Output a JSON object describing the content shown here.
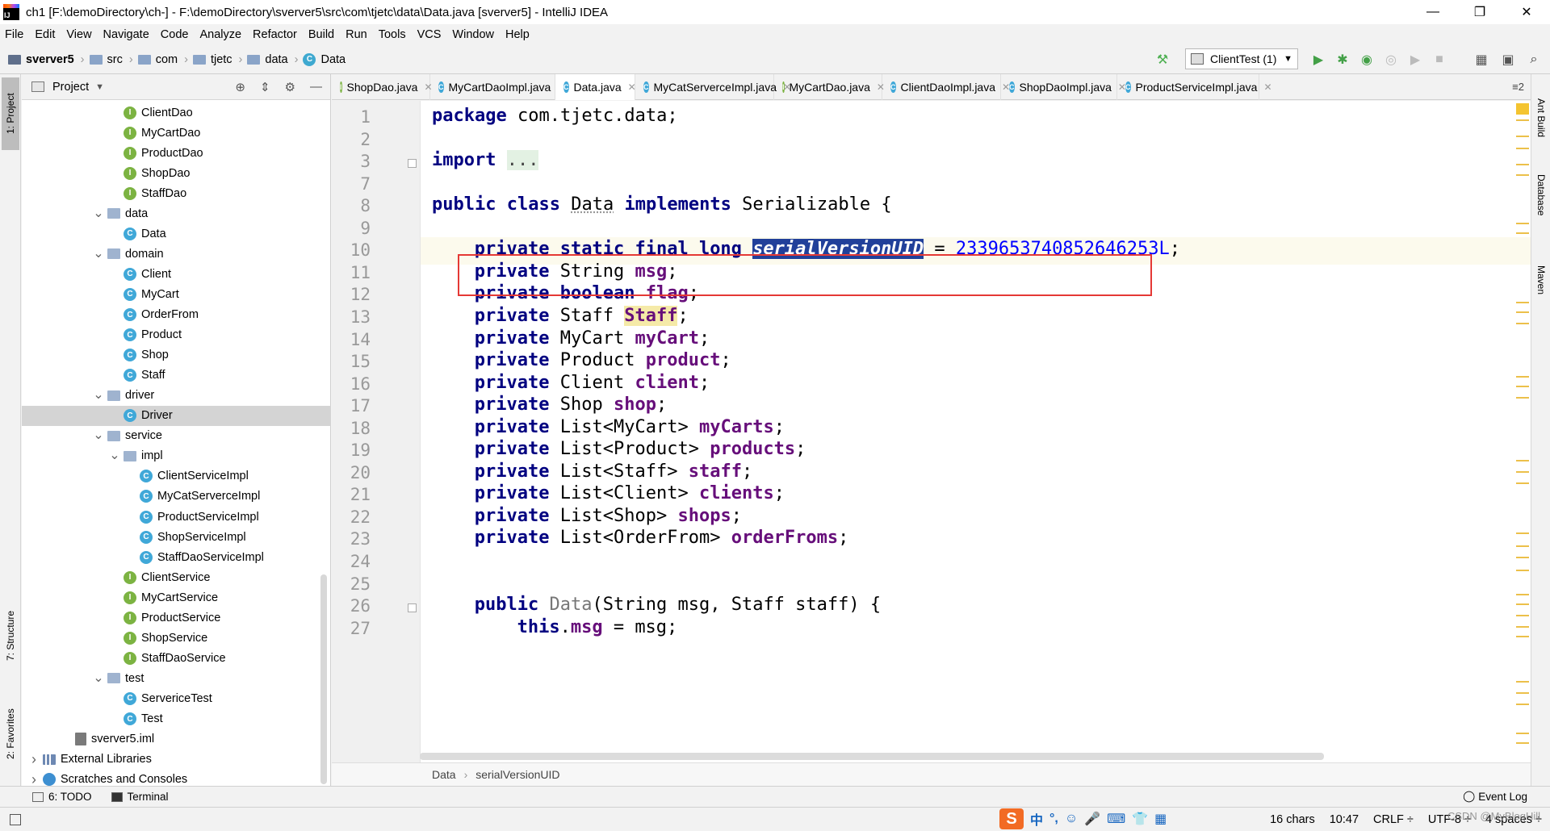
{
  "window": {
    "title": "ch1 [F:\\demoDirectory\\ch-] - F:\\demoDirectory\\sverver5\\src\\com\\tjetc\\data\\Data.java [sverver5] - IntelliJ IDEA",
    "min": "—",
    "max": "❐",
    "close": "✕"
  },
  "menu": [
    "File",
    "Edit",
    "View",
    "Navigate",
    "Code",
    "Analyze",
    "Refactor",
    "Build",
    "Run",
    "Tools",
    "VCS",
    "Window",
    "Help"
  ],
  "breadcrumb": {
    "project": "sverver5",
    "parts": [
      "src",
      "com",
      "tjetc",
      "data"
    ],
    "file": "Data"
  },
  "toolbar": {
    "run_config": "ClientTest (1)",
    "icons": [
      "hammer-icon",
      "run-icon",
      "debug-icon",
      "coverage-icon",
      "profile-icon",
      "run-gray-icon",
      "stop-icon",
      "project-structure-icon",
      "layout-icon",
      "search-icon"
    ]
  },
  "left_strip": {
    "project": "1: Project",
    "structure": "7: Structure",
    "favorites": "2: Favorites"
  },
  "right_strip": {
    "ant": "Ant Build",
    "database": "Database",
    "maven": "Maven"
  },
  "project_panel": {
    "title": "Project",
    "tree": [
      {
        "label": "ClientDao",
        "type": "interface",
        "depth": 5
      },
      {
        "label": "MyCartDao",
        "type": "interface",
        "depth": 5
      },
      {
        "label": "ProductDao",
        "type": "interface",
        "depth": 5
      },
      {
        "label": "ShopDao",
        "type": "interface",
        "depth": 5
      },
      {
        "label": "StaffDao",
        "type": "interface",
        "depth": 5
      },
      {
        "label": "data",
        "type": "folder",
        "depth": 4,
        "expanded": true
      },
      {
        "label": "Data",
        "type": "class",
        "depth": 5
      },
      {
        "label": "domain",
        "type": "folder",
        "depth": 4,
        "expanded": true
      },
      {
        "label": "Client",
        "type": "class",
        "depth": 5
      },
      {
        "label": "MyCart",
        "type": "class",
        "depth": 5
      },
      {
        "label": "OrderFrom",
        "type": "class",
        "depth": 5
      },
      {
        "label": "Product",
        "type": "class",
        "depth": 5
      },
      {
        "label": "Shop",
        "type": "class",
        "depth": 5
      },
      {
        "label": "Staff",
        "type": "class",
        "depth": 5
      },
      {
        "label": "driver",
        "type": "folder",
        "depth": 4,
        "expanded": true
      },
      {
        "label": "Driver",
        "type": "class",
        "depth": 5,
        "selected": true
      },
      {
        "label": "service",
        "type": "folder",
        "depth": 4,
        "expanded": true
      },
      {
        "label": "impl",
        "type": "folder",
        "depth": 5,
        "expanded": true
      },
      {
        "label": "ClientServiceImpl",
        "type": "class",
        "depth": 6
      },
      {
        "label": "MyCatServerceImpl",
        "type": "class",
        "depth": 6
      },
      {
        "label": "ProductServiceImpl",
        "type": "class",
        "depth": 6
      },
      {
        "label": "ShopServiceImpl",
        "type": "class",
        "depth": 6
      },
      {
        "label": "StaffDaoServiceImpl",
        "type": "class",
        "depth": 6
      },
      {
        "label": "ClientService",
        "type": "interface",
        "depth": 5
      },
      {
        "label": "MyCartService",
        "type": "interface",
        "depth": 5
      },
      {
        "label": "ProductService",
        "type": "interface",
        "depth": 5
      },
      {
        "label": "ShopService",
        "type": "interface",
        "depth": 5
      },
      {
        "label": "StaffDaoService",
        "type": "interface",
        "depth": 5
      },
      {
        "label": "test",
        "type": "folder",
        "depth": 4,
        "expanded": true
      },
      {
        "label": "ServericeTest",
        "type": "class",
        "depth": 5
      },
      {
        "label": "Test",
        "type": "class",
        "depth": 5
      },
      {
        "label": "sverver5.iml",
        "type": "iml",
        "depth": 2
      },
      {
        "label": "External Libraries",
        "type": "lib",
        "depth": 0,
        "collapsed": true
      },
      {
        "label": "Scratches and Consoles",
        "type": "scratch",
        "depth": 0,
        "collapsed": true
      }
    ]
  },
  "tabs": [
    {
      "label": "ShopDao.java",
      "kind": "interface"
    },
    {
      "label": "MyCartDaoImpl.java",
      "kind": "class"
    },
    {
      "label": "Data.java",
      "kind": "class",
      "active": true
    },
    {
      "label": "MyCatServerceImpl.java",
      "kind": "class"
    },
    {
      "label": "MyCartDao.java",
      "kind": "interface"
    },
    {
      "label": "ClientDaoImpl.java",
      "kind": "class"
    },
    {
      "label": "ShopDaoImpl.java",
      "kind": "class"
    },
    {
      "label": "ProductServiceImpl.java",
      "kind": "class"
    }
  ],
  "tabs_overflow": "≡2",
  "editor": {
    "lines": [
      {
        "n": "1"
      },
      {
        "n": "2"
      },
      {
        "n": "3"
      },
      {
        "n": "7"
      },
      {
        "n": "8"
      },
      {
        "n": "9"
      },
      {
        "n": "10"
      },
      {
        "n": "11"
      },
      {
        "n": "12"
      },
      {
        "n": "13"
      },
      {
        "n": "14"
      },
      {
        "n": "15"
      },
      {
        "n": "16"
      },
      {
        "n": "17"
      },
      {
        "n": "18"
      },
      {
        "n": "19"
      },
      {
        "n": "20"
      },
      {
        "n": "21"
      },
      {
        "n": "22"
      },
      {
        "n": "23"
      },
      {
        "n": "24"
      },
      {
        "n": "25"
      },
      {
        "n": "26"
      },
      {
        "n": "27"
      }
    ],
    "code": {
      "package_kw": "package",
      "package_name": " com.tjetc.data;",
      "import_kw": "import",
      "import_dots": "...",
      "class_decl": {
        "public": "public",
        "class": "class",
        "name": "Data",
        "implements": "implements",
        "iface": "Serializable",
        "brace": " {"
      },
      "serial": {
        "mods": "private static final long",
        "name": "serialVersionUID",
        "eq": " = ",
        "value": "2339653740852646253L",
        "end": ";"
      },
      "fields": [
        {
          "type": "String",
          "name": "msg"
        },
        {
          "type": "boolean",
          "name": "flag",
          "primitive": true
        },
        {
          "type": "Staff",
          "name": "Staff",
          "highlight": true
        },
        {
          "type": "MyCart",
          "name": "myCart"
        },
        {
          "type": "Product",
          "name": "product"
        },
        {
          "type": "Client",
          "name": "client"
        },
        {
          "type": "Shop",
          "name": "shop"
        },
        {
          "type": "List<MyCart>",
          "name": "myCarts"
        },
        {
          "type": "List<Product>",
          "name": "products"
        },
        {
          "type": "List<Staff>",
          "name": "staff"
        },
        {
          "type": "List<Client>",
          "name": "clients"
        },
        {
          "type": "List<Shop>",
          "name": "shops"
        },
        {
          "type": "List<OrderFrom>",
          "name": "orderFroms"
        }
      ],
      "private_kw": "private",
      "ctor": {
        "public": "public",
        "name": "Data",
        "params": "(String msg, Staff staff) {"
      },
      "this_line": {
        "this": "this",
        "field": "msg",
        "rest": " = msg;"
      }
    }
  },
  "editor_breadcrumb": [
    "Data",
    "serialVersionUID"
  ],
  "bottom_tabs": {
    "todo": "6: TODO",
    "terminal": "Terminal",
    "event_log": "Event Log"
  },
  "status": {
    "chars": "16 chars",
    "position": "10:47",
    "line_sep": "CRLF ÷",
    "encoding": "UTF-8 ÷",
    "indent": "4 spaces ÷",
    "ime_chars": [
      "中",
      "°,",
      "☺",
      "🎤",
      "⌨",
      "👕",
      "▦"
    ]
  },
  "watermark": "CSDN @MyBlogHill",
  "colors": {
    "keyword": "#000080",
    "field": "#660e7a",
    "number": "#0000ff",
    "selection": "#21409a",
    "annotation_box": "#e53935"
  }
}
